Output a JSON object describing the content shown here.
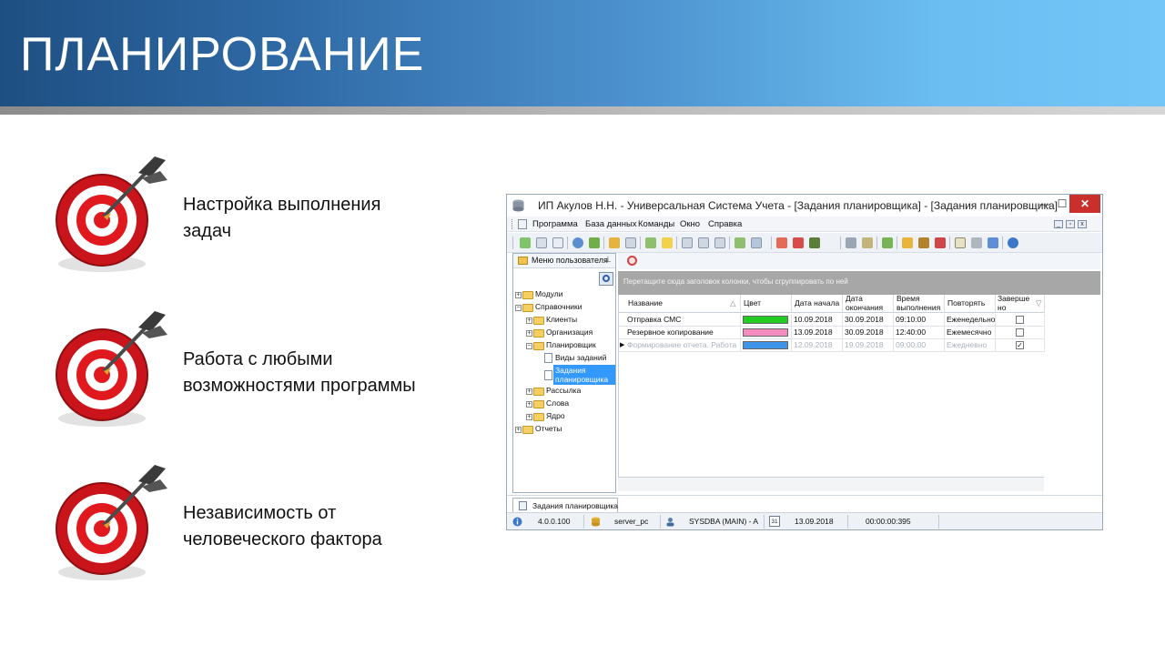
{
  "slide": {
    "title": "ПЛАНИРОВАНИЕ",
    "bullets": [
      {
        "line1": "Настройка выполнения",
        "line2": "задач"
      },
      {
        "line1": "Работа с любыми",
        "line2": "возможностями программы"
      },
      {
        "line1": "Независимость от",
        "line2": "человеческого фактора"
      }
    ]
  },
  "window": {
    "title": "ИП Акулов Н.Н. - Универсальная Система Учета - [Задания планировщика] - [Задания планировщика]",
    "controls": {
      "minimize": "—",
      "maximize": "☐",
      "close": "✕"
    },
    "menu": [
      "Программа",
      "База данных",
      "Команды",
      "Окно",
      "Справка"
    ],
    "left_panel": {
      "title": "Меню пользователя",
      "tree": [
        {
          "label": "Модули",
          "level": 0,
          "expander": "+"
        },
        {
          "label": "Справочники",
          "level": 0,
          "expander": "−"
        },
        {
          "label": "Клиенты",
          "level": 1,
          "expander": "+"
        },
        {
          "label": "Организация",
          "level": 1,
          "expander": "+"
        },
        {
          "label": "Планировщик",
          "level": 1,
          "expander": "−"
        },
        {
          "label": "Виды заданий",
          "level": 2,
          "expander": ""
        },
        {
          "label": "Задания планировщика",
          "level": 2,
          "expander": "",
          "selected": true
        },
        {
          "label": "Рассылка",
          "level": 1,
          "expander": "+"
        },
        {
          "label": "Слова",
          "level": 1,
          "expander": "+"
        },
        {
          "label": "Ядро",
          "level": 1,
          "expander": "+"
        },
        {
          "label": "Отчеты",
          "level": 0,
          "expander": "+"
        }
      ]
    },
    "grid": {
      "group_hint": "Перетащите сюда заголовок колонки, чтобы сгруппировать по ней",
      "columns": [
        "Название",
        "Цвет",
        "Дата начала",
        "Дата окончания",
        "Время выполнения",
        "Повторять",
        "Завершено"
      ],
      "rows": [
        {
          "name": "Отправка СМС",
          "color": "#22cc22",
          "start": "10.09.2018",
          "end": "30.09.2018",
          "time": "09:10:00",
          "repeat": "Еженедельно",
          "done": false,
          "dim": false
        },
        {
          "name": "Резервное копирование",
          "color": "#f48cc0",
          "start": "13.09.2018",
          "end": "30.09.2018",
          "time": "12:40:00",
          "repeat": "Ежемесячно",
          "done": false,
          "dim": false
        },
        {
          "name": "Формирование отчета. Работа",
          "color": "#3d94e8",
          "start": "12.09.2018",
          "end": "19.09.2018",
          "time": "09:00:00",
          "repeat": "Ежедневно",
          "done": true,
          "dim": true
        }
      ]
    },
    "tab": "Задания планировщика",
    "status": {
      "version": "4.0.0.100",
      "server": "server_pc",
      "user": "SYSDBA (MAIN) - A",
      "calendar_day": "31",
      "date": "13.09.2018",
      "elapsed": "00:00:00:395"
    }
  },
  "colors": {
    "accent": "#1e4f82",
    "close_button": "#c9302c",
    "selection": "#3399ff"
  }
}
